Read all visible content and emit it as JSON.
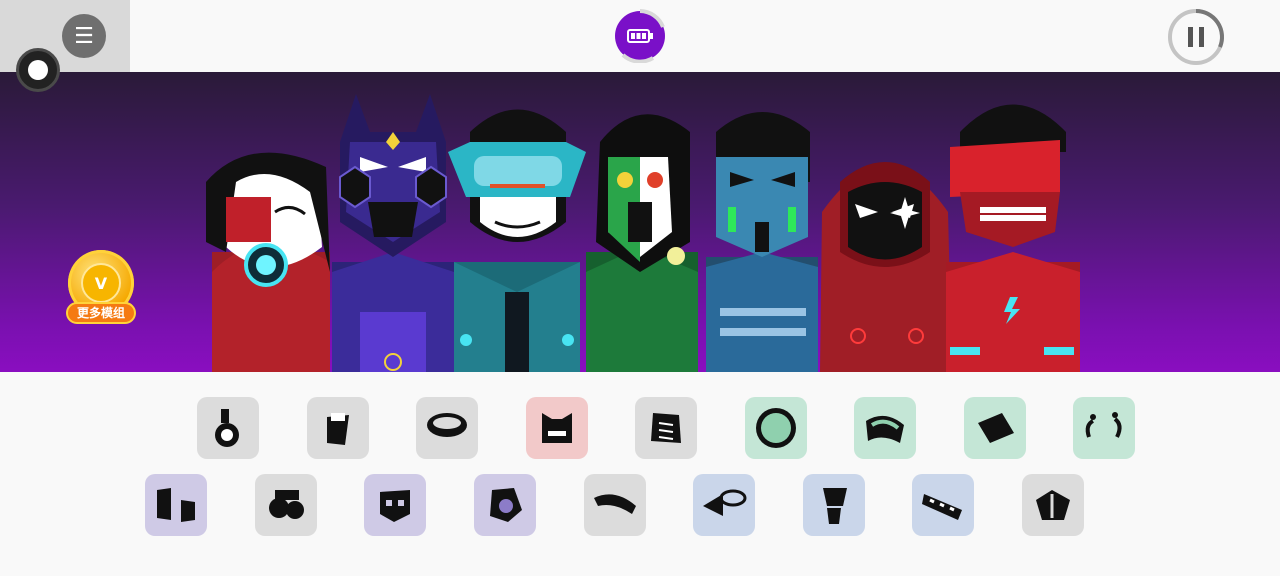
{
  "more_mods": {
    "label": "更多模组",
    "badge": "V"
  },
  "top": {
    "menu_icon": "menu-icon",
    "battery_icon": "battery-icon",
    "pause_icon": "pause-icon"
  },
  "colors": {
    "stage_top": "#2a1a38",
    "stage_bottom": "#8a0ec0",
    "battery": "#7a10c8"
  },
  "characters": [
    {
      "name": "red-cyborg",
      "color": "#b3222a"
    },
    {
      "name": "purple-demon",
      "color": "#3b2c9a"
    },
    {
      "name": "teal-visor",
      "color": "#1f8a9a"
    },
    {
      "name": "green-shaman",
      "color": "#1d7a3a"
    },
    {
      "name": "blue-robot",
      "color": "#2a6a9a"
    },
    {
      "name": "red-hood",
      "color": "#a82028"
    },
    {
      "name": "red-helmet",
      "color": "#c9202c"
    }
  ],
  "sound_icons_row1": [
    {
      "name": "beat-icon-1",
      "bg": "#dcdcdc"
    },
    {
      "name": "beat-icon-2",
      "bg": "#dcdcdc"
    },
    {
      "name": "beat-icon-3",
      "bg": "#dcdcdc"
    },
    {
      "name": "effect-icon-1",
      "bg": "#f2c9c9"
    },
    {
      "name": "effect-icon-2",
      "bg": "#dcdcdc"
    },
    {
      "name": "melody-icon-1",
      "bg": "#c4e6d6"
    },
    {
      "name": "melody-icon-2",
      "bg": "#c4e6d6"
    },
    {
      "name": "melody-icon-3",
      "bg": "#c4e6d6"
    },
    {
      "name": "melody-icon-4",
      "bg": "#c4e6d6"
    }
  ],
  "sound_icons_row2": [
    {
      "name": "voice-icon-1",
      "bg": "#cfcae6"
    },
    {
      "name": "voice-icon-2",
      "bg": "#dcdcdc"
    },
    {
      "name": "voice-icon-3",
      "bg": "#cfcae6"
    },
    {
      "name": "voice-icon-4",
      "bg": "#cfcae6"
    },
    {
      "name": "voice-icon-5",
      "bg": "#dcdcdc"
    },
    {
      "name": "voice-icon-6",
      "bg": "#cad6ea"
    },
    {
      "name": "voice-icon-7",
      "bg": "#cad6ea"
    },
    {
      "name": "voice-icon-8",
      "bg": "#cad6ea"
    },
    {
      "name": "voice-icon-9",
      "bg": "#dcdcdc"
    }
  ]
}
